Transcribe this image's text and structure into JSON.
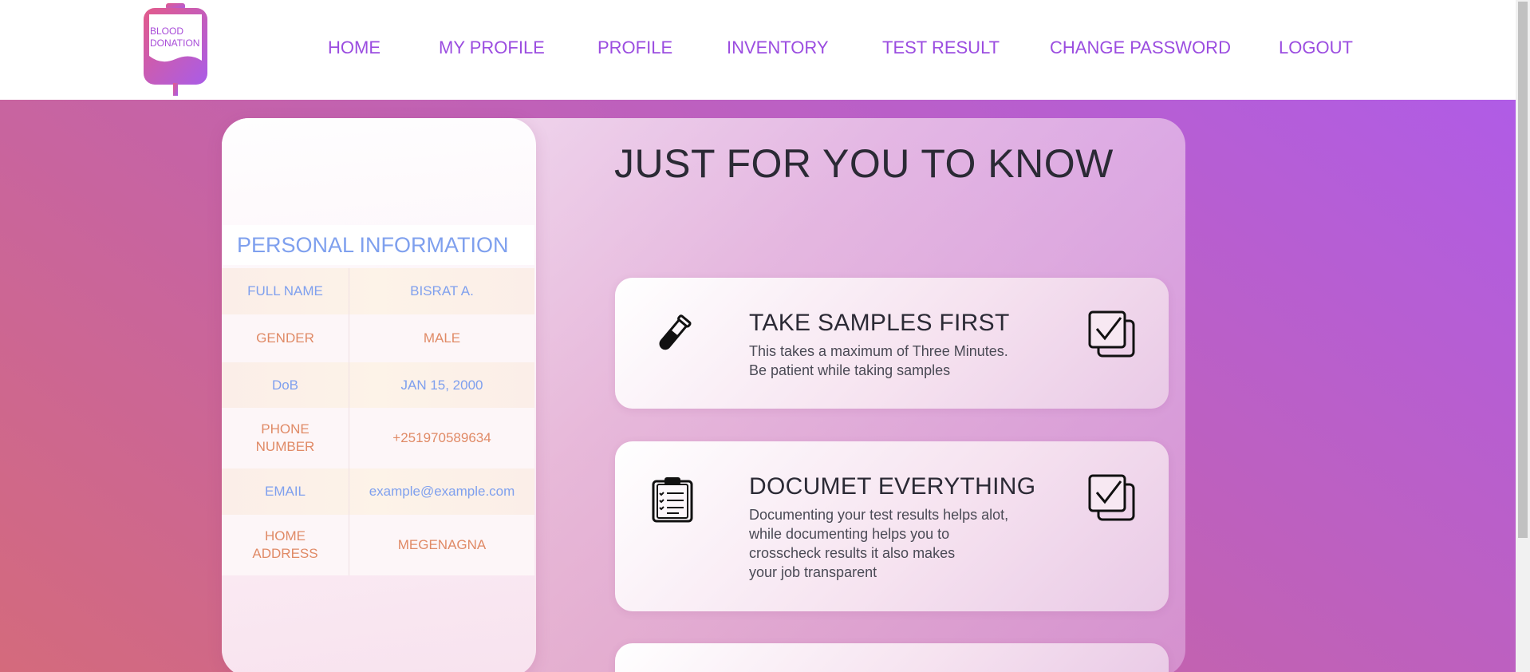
{
  "navbar": {
    "logo_text": "BLOOD DONATION",
    "links": [
      {
        "label": "HOME"
      },
      {
        "label": "MY PROFILE"
      },
      {
        "label": "PROFILE"
      },
      {
        "label": "INVENTORY"
      },
      {
        "label": "TEST RESULT"
      },
      {
        "label": "CHANGE PASSWORD"
      },
      {
        "label": "LOGOUT"
      }
    ]
  },
  "profile": {
    "title": "PERSONAL INFORMATION",
    "rows": [
      {
        "label": "FULL NAME",
        "value": "BISRAT A."
      },
      {
        "label": "GENDER",
        "value": "MALE"
      },
      {
        "label": "DoB",
        "value": "JAN 15, 2000"
      },
      {
        "label": "PHONE NUMBER",
        "value": "+251970589634"
      },
      {
        "label": "EMAIL",
        "value": "example@example.com"
      },
      {
        "label": "HOME ADDRESS",
        "value": "MEGENAGNA"
      }
    ]
  },
  "main": {
    "heading": "JUST FOR YOU TO KNOW",
    "cards": [
      {
        "title": "TAKE SAMPLES FIRST",
        "lines": [
          "This takes a maximum of Three Minutes.",
          "Be patient while taking samples"
        ],
        "icon": "test-tube-icon"
      },
      {
        "title": "DOCUMET EVERYTHING",
        "lines": [
          "Documenting your test results helps alot,",
          "while documenting helps you to",
          "crosscheck results it also makes",
          "your job transparent"
        ],
        "icon": "clipboard-icon"
      }
    ]
  },
  "colors": {
    "accent": "#9b4de0",
    "label_blue": "#7fa0ee",
    "label_orange": "#e08a66"
  }
}
